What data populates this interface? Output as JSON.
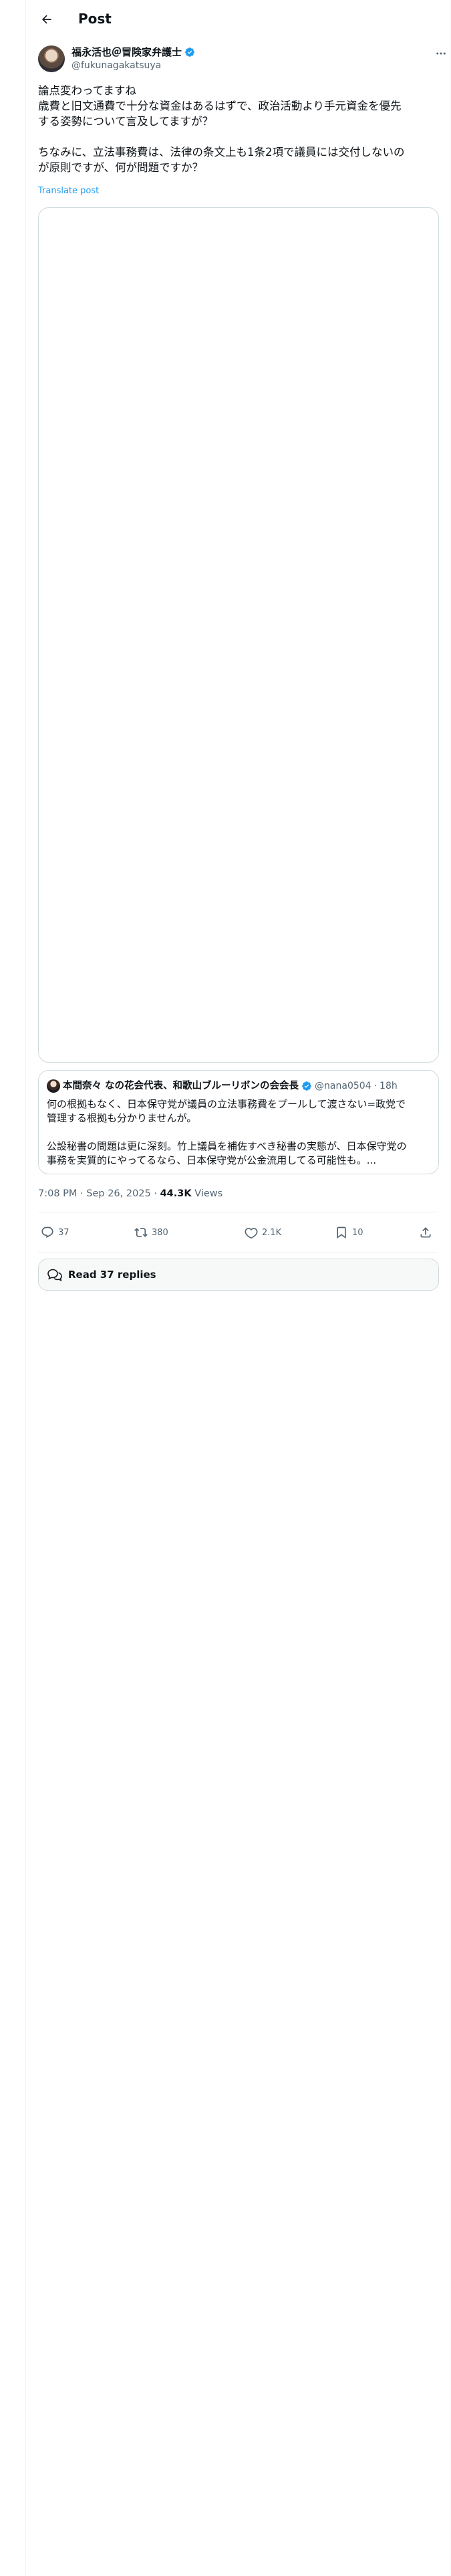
{
  "header": {
    "title": "Post"
  },
  "author": {
    "name": "福永活也＠冒険家弁護士",
    "handle": "@fukunagakatsuya"
  },
  "tweet": {
    "lines": [
      "論点変わってますね",
      "歳費と旧文通費で十分な資金はあるはずで、政治活動より手元資金を優先",
      "する姿勢について言及してますが？",
      "ちなみに、立法事務費は、法律の条文上も1条2項で議員には交付しないの",
      "が原則ですが、何が問題ですか？"
    ],
    "translate": "Translate post"
  },
  "quote": {
    "name": "本間奈々 なの花会代表、和歌山ブルーリボンの会会長",
    "handle": "@nana0504",
    "dot": "·",
    "time": "18h",
    "lines": [
      "何の根拠もなく、日本保守党が議員の立法事務費をプールして渡さない=政党で",
      "管理する根拠も分かりませんが。",
      "公設秘書の問題は更に深刻。竹上議員を補佐すべき秘書の実態が、日本保守党の",
      "事務を実質的にやってるなら、日本保守党が公金流用してる可能性も。..."
    ]
  },
  "meta": {
    "timestamp": "7:08 PM · Sep 26, 2025 · ",
    "views_count": "44.3K",
    "views_label": " Views"
  },
  "actions": {
    "reply_count": "37",
    "repost_count": "380",
    "like_count": "2.1K",
    "bookmark_count": "10"
  },
  "replies": {
    "label": "Read 37 replies"
  },
  "colors": {
    "accent": "#1d9bf0",
    "text": "#0f1419",
    "secondary": "#536471",
    "border": "#cfd9de"
  }
}
